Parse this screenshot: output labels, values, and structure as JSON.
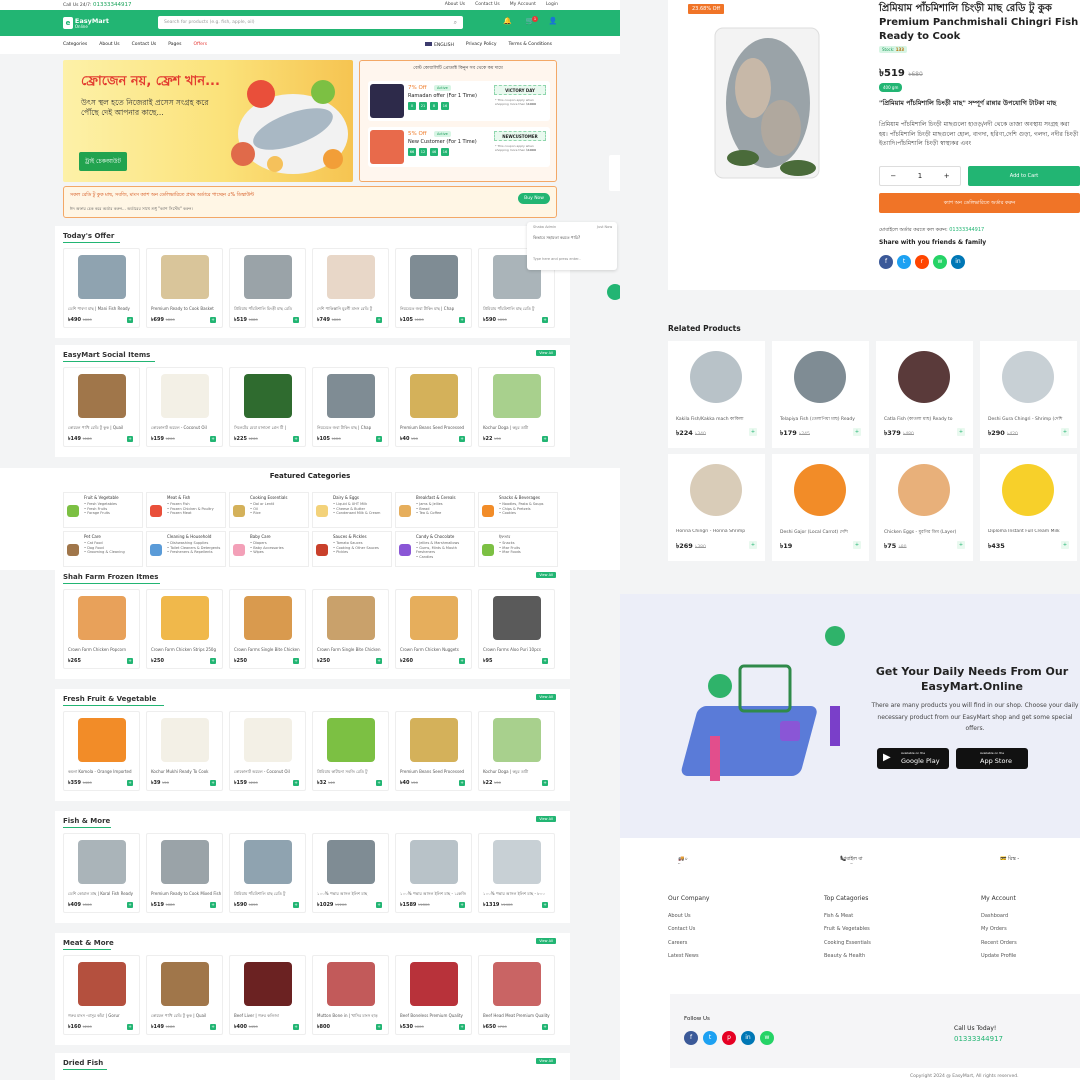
{
  "topbar": {
    "call_prefix": "Call Us 24/7:",
    "call_number": "01333344917",
    "links": [
      "About Us",
      "Contact Us",
      "My Account",
      "Login"
    ]
  },
  "header": {
    "logo_name": "EasyMart",
    "logo_sub": "Online",
    "search_placeholder": "Search for products (e.g. fish, apple, oil)",
    "cart_count": "1"
  },
  "nav": {
    "left": [
      "Categories",
      "About Us",
      "Contact Us",
      "Pages",
      "Offers"
    ],
    "right": [
      "ENGLISH",
      "Privacy Policy",
      "Terms & Conditions"
    ]
  },
  "banner": {
    "headline": "ফ্রোজেন নয়, ফ্রেশ খান...",
    "sub": "উৎস স্থল হতে নিজেরাই প্রসেস সংগ্রহ করে পৌঁছে দেই আপনার কাছে...",
    "button": "ট্রাই চেকআউট"
  },
  "coupons": {
    "title": "বেস্ট কোয়ালিটি প্রোডাক্ট কিনুন সব থেকে কম দামে",
    "items": [
      {
        "percent": "7% Off",
        "status": "Active",
        "name": "Ramadan offer (For 1 Time)",
        "timer": [
          "0",
          "21",
          "8",
          "16"
        ],
        "code": "VICTORY DAY",
        "terms": "* This coupon apply when shopping more then",
        "min": "৳1000"
      },
      {
        "percent": "5% Off",
        "status": "Active",
        "name": "New Customer (For 1 Time)",
        "timer": [
          "66",
          "12",
          "46",
          "16"
        ],
        "code": "NEWCUSTOMER",
        "terms": "* This coupon apply when shopping more then",
        "min": "৳1000"
      }
    ]
  },
  "notice": {
    "text": "সকল রেডি টু কুক মাছ, সবজি, মাংস ক্যাশ অন ডেলিভারিতে প্রথম অর্ডারে পাচ্ছেন ৫% ডিস্কাউন্ট",
    "sub": "ঈদ অফার চেক করে অর্ডার করুন... অর্ডারের সাথে শুধু \"ক্যাশ সিস্টেম\" করুন।",
    "button": "Buy Now"
  },
  "view_all": "View All",
  "sections": [
    {
      "title": "Today's Offer",
      "products": [
        {
          "name": "ডেশি পাবদা মাছ | Mani Fish Ready",
          "price": "৳490",
          "old": "৳600"
        },
        {
          "name": "Premium Ready to Cook Basket",
          "price": "৳699",
          "old": "৳800"
        },
        {
          "name": "প্রিমিয়াম পাঁচমিশালি চিংড়ী মাছ রেডি",
          "price": "৳519",
          "old": "৳680"
        },
        {
          "name": "দেশি পাকিস্তানি মুরগী মাংস রেডি টু",
          "price": "৳749",
          "old": "৳800"
        },
        {
          "name": "নিয়মেতে জবা টাকিং মাছ | Chap",
          "price": "৳105",
          "old": "৳120"
        },
        {
          "name": "প্রিমিয়াম পাঁচমিশালি মাছ রেডি টু",
          "price": "৳590",
          "old": "৳690"
        }
      ]
    },
    {
      "title": "EasyMart Social Items",
      "products": [
        {
          "name": "কোয়েল পাখি রেডি টু কুক | Quail",
          "price": "৳149",
          "old": "৳180"
        },
        {
          "name": "কোকোনাট অয়েল - Coconut Oil",
          "price": "৳159",
          "old": "৳200"
        },
        {
          "name": "সিলেটের মেয়া মানানো গ্রেন টি |",
          "price": "৳225",
          "old": "৳260"
        },
        {
          "name": "নিয়মেতে জবা টাকিং মাছ | Chap",
          "price": "৳105",
          "old": "৳120"
        },
        {
          "name": "Premium Beans Seed Processed",
          "price": "৳40",
          "old": "৳50"
        },
        {
          "name": "Kochur Doga | কচুর ডাটা",
          "price": "৳22",
          "old": "৳30"
        }
      ]
    },
    {
      "title": "Shah Farm Frozen Itmes",
      "products": [
        {
          "name": "Crown Farm Chicken Popcorn",
          "price": "৳265",
          "old": ""
        },
        {
          "name": "Crown Farm Chicken Strips 250g",
          "price": "৳250",
          "old": ""
        },
        {
          "name": "Crown Farms Single Bite Chicken",
          "price": "৳250",
          "old": ""
        },
        {
          "name": "Crown Farm Single Bite Chicken",
          "price": "৳250",
          "old": ""
        },
        {
          "name": "Crown Farm Chicken Nuggets",
          "price": "৳260",
          "old": ""
        },
        {
          "name": "Crown Farms Aloo Puri 10pcs",
          "price": "৳95",
          "old": ""
        }
      ]
    },
    {
      "title": "Fresh Fruit & Vegetable",
      "products": [
        {
          "name": "কমলা Komola - Orange Imported",
          "price": "৳359",
          "old": "৳400"
        },
        {
          "name": "Kochur Mukhi Ready To Cook",
          "price": "৳39",
          "old": "৳50"
        },
        {
          "name": "কোকোনাট অয়েল - Coconut Oil",
          "price": "৳159",
          "old": "৳200"
        },
        {
          "name": "প্রিমিয়াম কাটানো সবজি রেডি টু",
          "price": "৳32",
          "old": "৳40"
        },
        {
          "name": "Premium Beans Seed Processed",
          "price": "৳40",
          "old": "৳50"
        },
        {
          "name": "Kochur Doga | কচুর ডাটা",
          "price": "৳22",
          "old": "৳30"
        }
      ]
    },
    {
      "title": "Fish & More",
      "products": [
        {
          "name": "ডেশি কোরাল মাছ | Koral Fish Ready",
          "price": "৳409",
          "old": "৳500"
        },
        {
          "name": "Premium Ready to Cook Mixed Fish",
          "price": "৳519",
          "old": "৳680"
        },
        {
          "name": "প্রিমিয়াম পাঁচমিশালি মাছ রেডি টু",
          "price": "৳590",
          "old": "৳690"
        },
        {
          "name": "১০০% পদ্মার আসল ইলিশ মাছ",
          "price": "৳1029",
          "old": "৳1200"
        },
        {
          "name": "১০০% পদ্মার আসল ইলিশ মাছ - ১কেজি",
          "price": "৳1589",
          "old": "৳1800"
        },
        {
          "name": "১০০% পদ্মার আসল ইলিশ মাছ - ৮০০",
          "price": "৳1319",
          "old": "৳1400"
        }
      ]
    },
    {
      "title": "Meat & More",
      "products": [
        {
          "name": "গরুর মাংস -বাসুর কাঁচা | Gorur",
          "price": "৳160",
          "old": "৳200"
        },
        {
          "name": "কোয়েল পাখি রেডি টু কুক | Quail",
          "price": "৳149",
          "old": "৳180"
        },
        {
          "name": "Beef Liver | গরুর কলিজা",
          "price": "৳400",
          "old": "৳450"
        },
        {
          "name": "Mutton Bone in | খাসির মাংস হাড়",
          "price": "৳800",
          "old": ""
        },
        {
          "name": "Beef Boneless Premium Quality",
          "price": "৳530",
          "old": "৳600"
        },
        {
          "name": "Beef Head Meat Premium Quality",
          "price": "৳650",
          "old": "৳700"
        }
      ]
    },
    {
      "title": "Dried Fish",
      "products": []
    }
  ],
  "featured": {
    "title": "Featured Categories",
    "items": [
      {
        "name": "Fruit & Vegetable",
        "subs": [
          "Fresh Vegetables",
          "Fresh Fruits",
          "Forage Fruits"
        ]
      },
      {
        "name": "Meat & Fish",
        "subs": [
          "Frozen Fish",
          "Frozen Chicken & Poultry",
          "Frozen Meat"
        ]
      },
      {
        "name": "Cooking Essentials",
        "subs": [
          "Dal or Lentil",
          "Oil",
          "Rice"
        ]
      },
      {
        "name": "Dairy & Eggs",
        "subs": [
          "Liquid & UHT Milk",
          "Cheese & Butter",
          "Condensed Milk & Cream"
        ]
      },
      {
        "name": "Breakfast & Cereals",
        "subs": [
          "Jams & Jellies",
          "Bread",
          "Tea & Coffee"
        ]
      },
      {
        "name": "Snacks & Beverages",
        "subs": [
          "Noodles, Pasta & Soups",
          "Chips & Pretzels",
          "Cookies"
        ]
      },
      {
        "name": "Pet Care",
        "subs": [
          "Cat Food",
          "Dog Food",
          "Grooming & Cleaning"
        ]
      },
      {
        "name": "Cleaning & Household",
        "subs": [
          "Dishwashing Supplies",
          "Toilet Cleaners & Detergents",
          "Fresheners & Repellents"
        ]
      },
      {
        "name": "Baby Care",
        "subs": [
          "Diapers",
          "Baby Accessories",
          "Wipes"
        ]
      },
      {
        "name": "Sauces & Pickles",
        "subs": [
          "Tomato Sauces",
          "Cooking & Other Sauces",
          "Pickles"
        ]
      },
      {
        "name": "Candy & Chocolate",
        "subs": [
          "Jellies & Marshmallows",
          "Gums, Mints & Mouth Fresheners",
          "Candies"
        ]
      },
      {
        "name": "ইফতার",
        "subs": [
          "Snacks",
          "Iftar Fruits",
          "Iftar Foods"
        ]
      }
    ]
  },
  "chat": {
    "agent": "Shaba Admin",
    "message": "কিভাবে সহায়তা করতে পারি?",
    "input": "Type here and press enter..",
    "time": "Just Now"
  },
  "product": {
    "discount": "23.68% Off",
    "title_bn": "প্রিমিয়াম পাঁচমিশালি চিংড়ী মাছ রেডি টু কুক",
    "title_en": "Premium Panchmishali Chingri Fish Ready to Cook",
    "stock_label": "Stock:",
    "stock_value": "133",
    "price": "৳519",
    "old_price": "৳680",
    "weight": "400 gm",
    "desc_head": "\"প্রিমিয়াম পাঁচমিশালি চিংড়ী মাছ\" সম্পূর্ণ রান্নার উপযোগি টাটকা মাছ",
    "desc_body": "প্রিমিয়াম পাঁচমিশালি চিংড়ী মাছগুলো হাওড়/নদী থেকে তাজা অবস্থায় সংগ্রহ করা হয়। পাঁচমিশালি চিংড়ী মাছগুলো হোল, বাগদা, হরিণা,দেশি গুড়া, গলদা, নদীর চিংড়ী ইত্যাদি।পাঁচমিশালি চিংড়ী স্বাস্থ্যকর এবং",
    "qty": "1",
    "add_to_cart": "Add to Cart",
    "cod_button": "ক্যাশ অন ডেলিভারিতে অর্ডার করুন",
    "call_text": "মোবাইলে অর্ডার করতে কল করুন:",
    "call_number": "01333344917",
    "share": "Share with you friends & family"
  },
  "related": {
    "title": "Related Products",
    "items": [
      {
        "name": "Kakila Fish/Kakka mach কাকিলা",
        "price": "৳224",
        "old": "৳340"
      },
      {
        "name": "Telapiya Fish (তেলাপিয়া মাছ) Ready",
        "price": "৳179",
        "old": "৳245"
      },
      {
        "name": "Catla Fish (কাতলা মাছ) Ready to",
        "price": "৳379",
        "old": "৳480"
      },
      {
        "name": "Deshi Gura Chingri - Shrimp (দেশি",
        "price": "৳290",
        "old": "৳420"
      },
      {
        "name": "Horina Chingri - Horina Shrimp",
        "price": "৳269",
        "old": "৳380"
      },
      {
        "name": "Deshi Gajor (Local Carrot) দেশি",
        "price": "৳19",
        "old": ""
      },
      {
        "name": "Chicken Eggs - মুরগির ডিম (Layer)",
        "price": "৳75",
        "old": "৳80"
      },
      {
        "name": "Diploma Instant Full Cream Milk",
        "price": "৳435",
        "old": ""
      }
    ]
  },
  "app": {
    "heading": "Get Your Daily Needs From Our EasyMart.Online",
    "text": "There are many products you will find in our shop. Choose your daily necessary product from our EasyMart shop and get some special offers.",
    "google_small": "Available on the",
    "google": "Google Play",
    "apple_small": "Available on the",
    "apple": "App Store"
  },
  "features": [
    "৫০০ টাকার পণ্য কিনলেই হোম ডেলিভারি ফ্রী",
    "মোবাইল বা হোয়াটসঅ্যাপে সাপোর্ট ২৪/৭",
    "নো রিস্ক - ক্যাশ অন ডেলিভারি"
  ],
  "footer": {
    "company": {
      "title": "Our Company",
      "links": [
        "About Us",
        "Contact Us",
        "Careers",
        "Latest News"
      ]
    },
    "categories": {
      "title": "Top Catagories",
      "links": [
        "Fish & Meat",
        "Fruit & Vegetables",
        "Cooking Essentials",
        "Beauty & Health"
      ]
    },
    "account": {
      "title": "My Account",
      "links": [
        "Dashboard",
        "My Orders",
        "Recent Orders",
        "Update Profile"
      ]
    },
    "follow": "Follow Us",
    "call_today": "Call Us Today!",
    "phone": "01333344917",
    "copyright": "Copyright 2024 @ EasyMart, All rights reserved."
  },
  "colors": {
    "brand": "#22b573",
    "accent": "#f07427",
    "sale": "#e53935"
  }
}
